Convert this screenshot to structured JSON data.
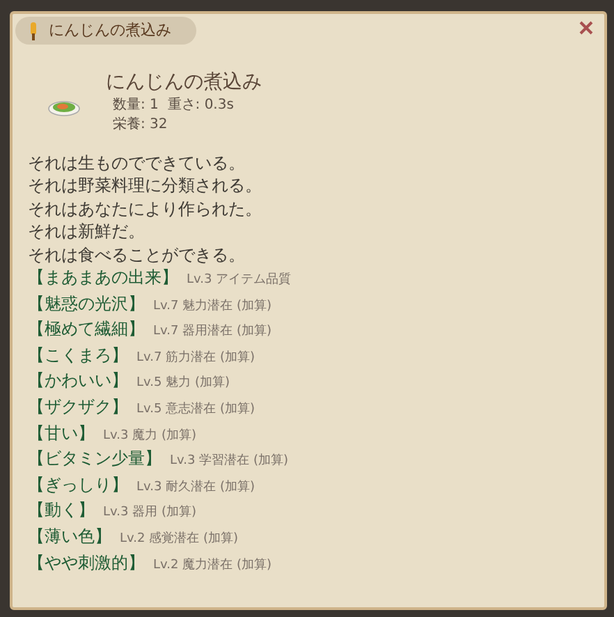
{
  "window": {
    "title": "にんじんの煮込み"
  },
  "item": {
    "name": "にんじんの煮込み",
    "stats": "数量: 1  重さ: 0.3s",
    "nutrition": "栄養: 32"
  },
  "descriptions": [
    "それは生ものでできている。",
    "それは野菜料理に分類される。",
    "それはあなたにより作られた。",
    "それは新鮮だ。",
    "それは食べることができる。"
  ],
  "traits": [
    {
      "name": "【まあまあの出来】",
      "detail": "Lv.3 アイテム品質"
    },
    {
      "name": "【魅惑の光沢】",
      "detail": "Lv.7 魅力潜在 (加算)"
    },
    {
      "name": "【極めて繊細】",
      "detail": "Lv.7 器用潜在 (加算)"
    },
    {
      "name": "【こくまろ】",
      "detail": "Lv.7 筋力潜在 (加算)"
    },
    {
      "name": "【かわいい】",
      "detail": "Lv.5 魅力 (加算)"
    },
    {
      "name": "【ザクザク】",
      "detail": "Lv.5 意志潜在 (加算)"
    },
    {
      "name": "【甘い】",
      "detail": "Lv.3 魔力 (加算)"
    },
    {
      "name": "【ビタミン少量】",
      "detail": "Lv.3 学習潜在 (加算)"
    },
    {
      "name": "【ぎっしり】",
      "detail": "Lv.3 耐久潜在 (加算)"
    },
    {
      "name": "【動く】",
      "detail": "Lv.3 器用 (加算)"
    },
    {
      "name": "【薄い色】",
      "detail": "Lv.2 感覚潜在 (加算)"
    },
    {
      "name": "【やや刺激的】",
      "detail": "Lv.2 魔力潜在 (加算)"
    }
  ]
}
